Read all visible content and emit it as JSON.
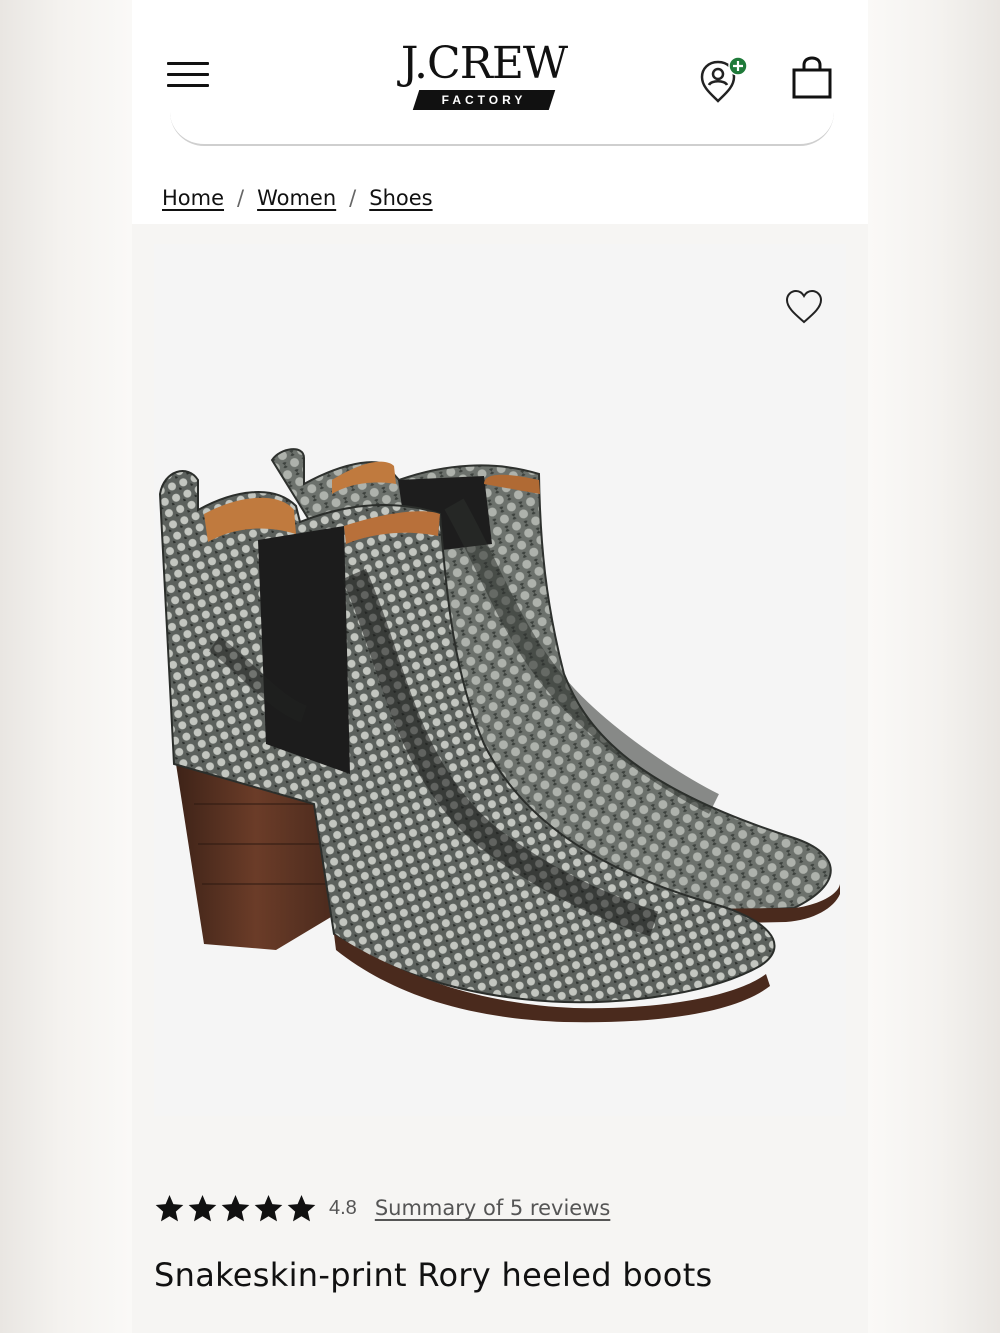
{
  "header": {
    "logo_main": "J.CREW",
    "logo_sub": "FACTORY",
    "menu_icon": "hamburger-menu-icon",
    "rewards_icon": "rewards-add-icon",
    "bag_icon": "shopping-bag-icon",
    "accent_color": "#1f7a3a"
  },
  "breadcrumb": {
    "items": [
      "Home",
      "Women",
      "Shoes"
    ],
    "separator": "/"
  },
  "product": {
    "image_icon": "product-photo",
    "wishlist_icon": "heart-outline-icon",
    "rating": {
      "value": "4.8",
      "stars": 5,
      "reviews_link": "Summary of 5 reviews"
    },
    "title": "Snakeskin-print Rory heeled boots"
  }
}
